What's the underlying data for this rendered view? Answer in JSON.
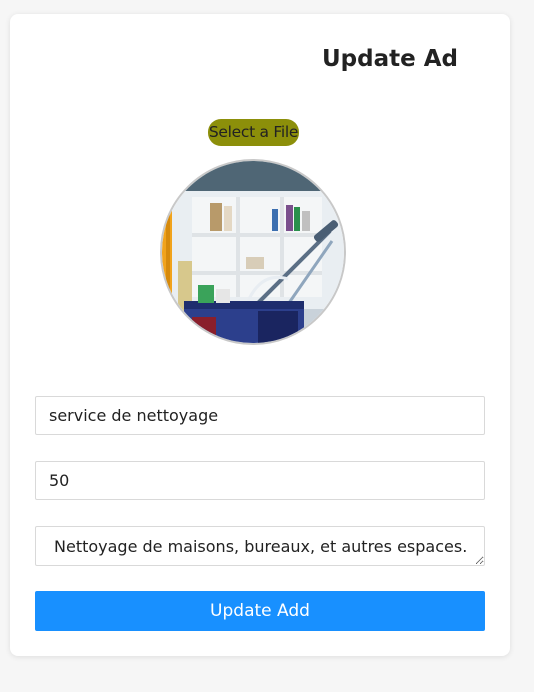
{
  "form": {
    "title": "Update Ad",
    "file_button_label": "Select a File",
    "fields": {
      "name_value": "service de nettoyage",
      "price_value": "50",
      "description_value": "Nettoyage de maisons, bureaux, et autres espaces."
    },
    "submit_label": "Update Add"
  },
  "colors": {
    "file_button": "#8c8f0a",
    "submit_button": "#1890ff",
    "card_background": "#ffffff",
    "page_background": "#f6f6f6"
  }
}
